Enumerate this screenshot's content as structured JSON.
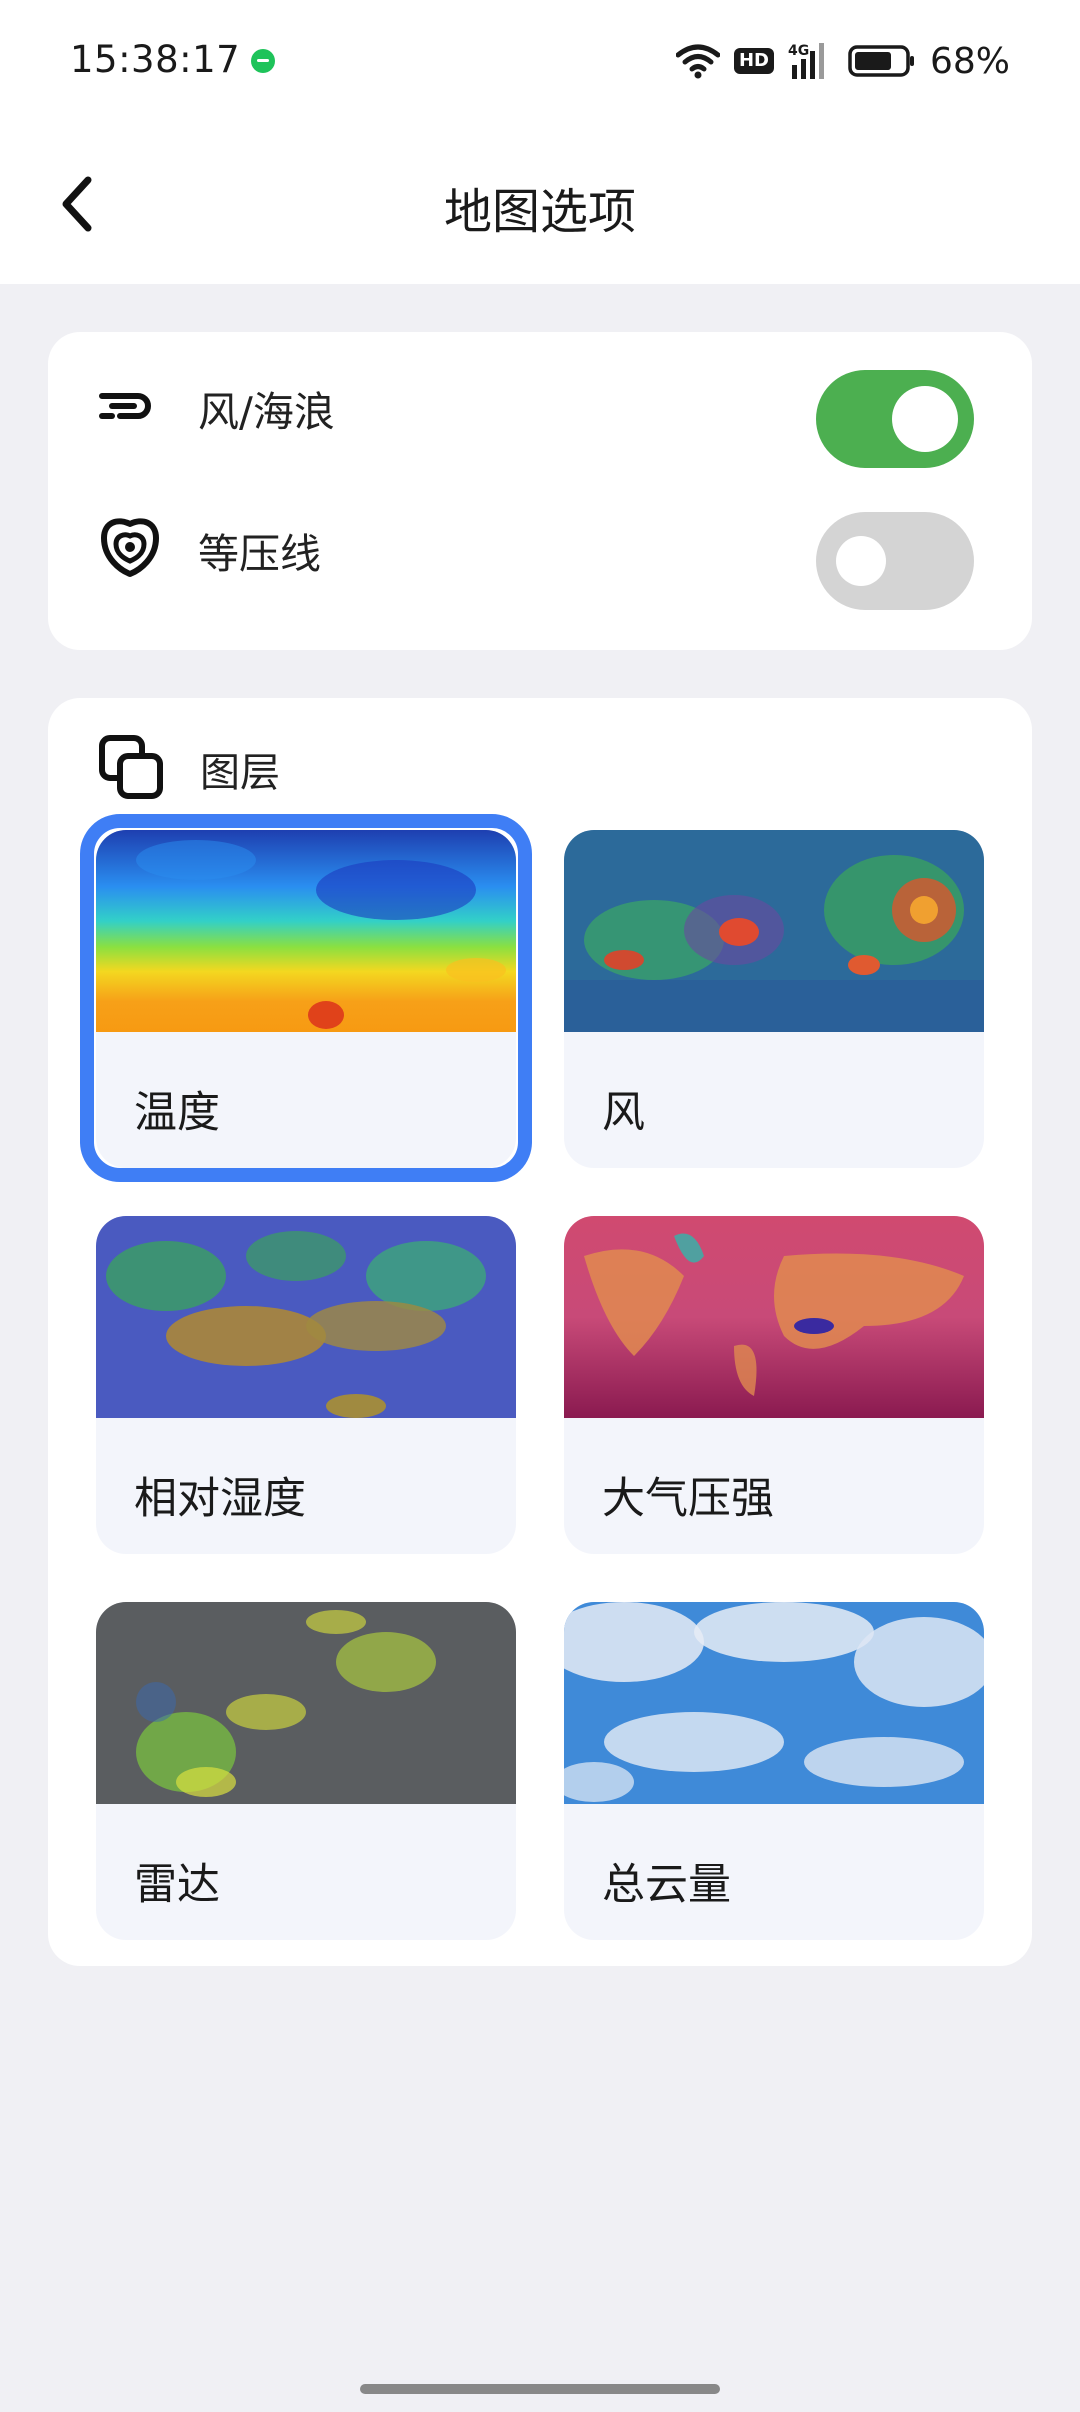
{
  "status_bar": {
    "time": "15:38:17",
    "battery": "68%",
    "network_badge": "HD",
    "network_type": "4G"
  },
  "header": {
    "title": "地图选项",
    "back_icon": "chevron-left-icon"
  },
  "toggles": [
    {
      "label": "风/海浪",
      "icon": "wind-wave-icon",
      "on": true
    },
    {
      "label": "等压线",
      "icon": "isobar-icon",
      "on": false
    }
  ],
  "layers": {
    "title": "图层",
    "icon": "layers-icon",
    "selected": "温度",
    "items": [
      {
        "label": "温度"
      },
      {
        "label": "风"
      },
      {
        "label": "相对湿度"
      },
      {
        "label": "大气压强"
      },
      {
        "label": "雷达"
      },
      {
        "label": "总云量"
      }
    ]
  },
  "colors": {
    "accent": "#3f7ef5",
    "toggle_on": "#4caf50",
    "toggle_off": "#d4d4d4",
    "background": "#f0f0f4"
  }
}
